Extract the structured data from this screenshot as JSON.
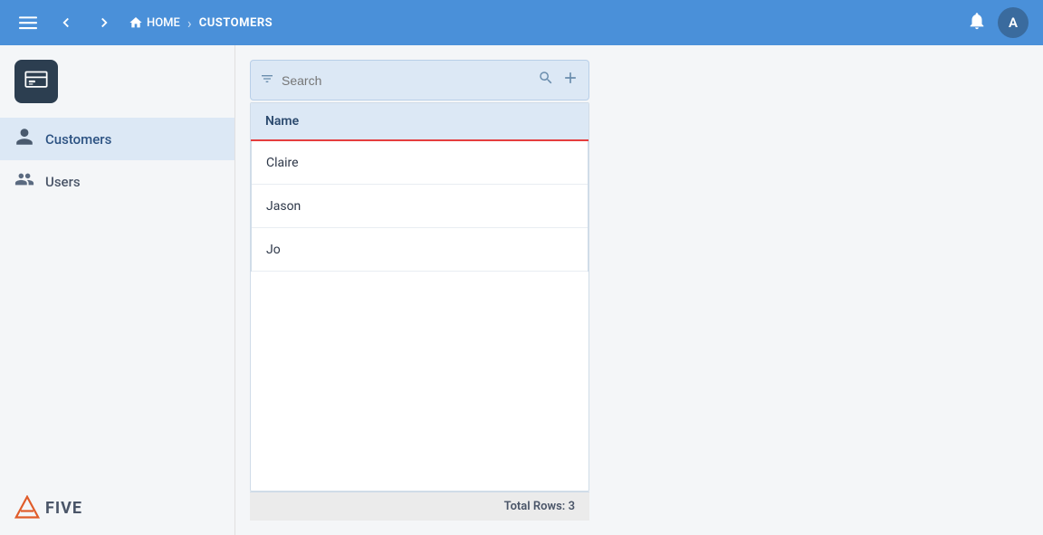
{
  "topnav": {
    "home_label": "HOME",
    "current_label": "CUSTOMERS",
    "avatar_letter": "A"
  },
  "sidebar": {
    "logo_icon": "🗒",
    "items": [
      {
        "label": "Customers",
        "icon": "person",
        "active": true
      },
      {
        "label": "Users",
        "icon": "group",
        "active": false
      }
    ],
    "five_logo_text": "FIVE"
  },
  "search": {
    "placeholder": "Search"
  },
  "table": {
    "header": "Name",
    "rows": [
      {
        "name": "Claire"
      },
      {
        "name": "Jason"
      },
      {
        "name": "Jo"
      }
    ],
    "footer": "Total Rows: 3"
  }
}
